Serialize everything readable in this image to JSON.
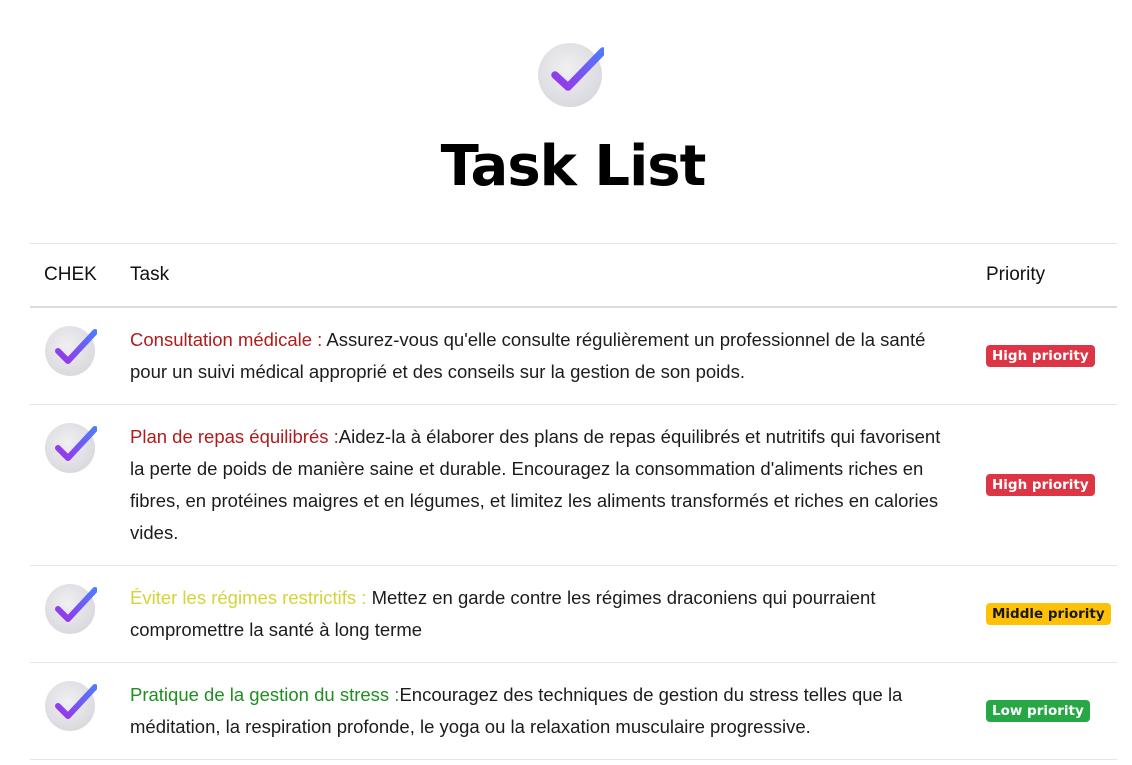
{
  "page": {
    "title": "Task List",
    "logo_icon": "checkmark-circle-icon"
  },
  "table": {
    "headers": {
      "check": "CHEK",
      "task": "Task",
      "priority": "Priority"
    },
    "rows": [
      {
        "check_icon": "checkmark-circle-icon",
        "label": "Consultation médicale : ",
        "label_color": "#b01c1c",
        "text": "Assurez-vous qu'elle consulte régulièrement un professionnel de la santé pour un suivi médical approprié et des conseils sur la gestion de son poids.",
        "priority": "High priority",
        "priority_bg": "#dc3545",
        "priority_fg": "#ffffff"
      },
      {
        "check_icon": "checkmark-circle-icon",
        "label": "Plan de repas équilibrés :",
        "label_color": "#b01c1c",
        "text": "Aidez-la à élaborer des plans de repas équilibrés et nutritifs qui favorisent la perte de poids de manière saine et durable. Encouragez la consommation d'aliments riches en fibres, en protéines maigres et en légumes, et limitez les aliments transformés et riches en calories vides.",
        "priority": "High priority",
        "priority_bg": "#dc3545",
        "priority_fg": "#ffffff"
      },
      {
        "check_icon": "checkmark-circle-icon",
        "label": "Éviter les régimes restrictifs : ",
        "label_color": "#d4d438",
        "text": "Mettez en garde contre les régimes draconiens qui pourraient compromettre la santé à long terme",
        "priority": "Middle priority",
        "priority_bg": "#ffc107",
        "priority_fg": "#1a1a1a"
      },
      {
        "check_icon": "checkmark-circle-icon",
        "label": "Pratique de la gestion du stress :",
        "label_color": "#1f8f1f",
        "text": "Encouragez des techniques de gestion du stress telles que la méditation, la respiration profonde, le yoga ou la relaxation musculaire progressive.",
        "priority": "Low priority",
        "priority_bg": "#28a745",
        "priority_fg": "#ffffff"
      }
    ]
  },
  "colors": {
    "check_gradient_start": "#9b33e8",
    "check_gradient_end": "#4f7bff",
    "check_circle": "#e4e4e8"
  }
}
